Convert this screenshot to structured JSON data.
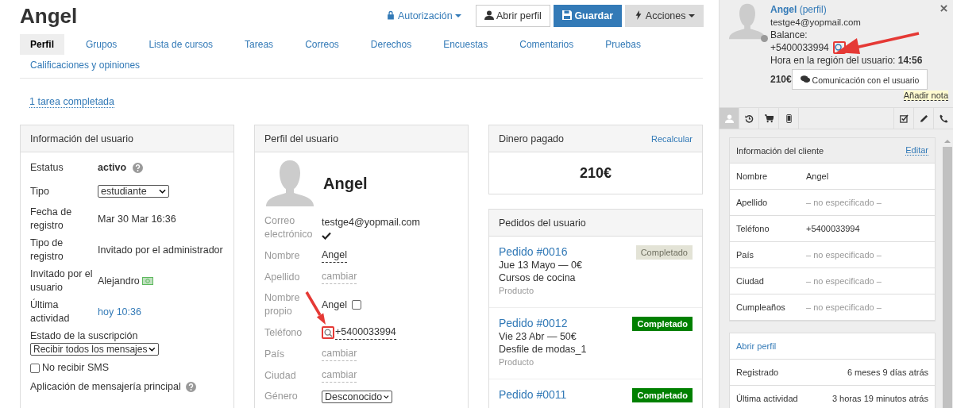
{
  "title": "Angel",
  "toolbar": {
    "authorization": "Autorización",
    "open_profile": "Abrir perfil",
    "save": "Guardar",
    "actions": "Acciones"
  },
  "tabs": [
    {
      "label": "Perfil",
      "selected": true
    },
    {
      "label": "Grupos",
      "selected": false
    },
    {
      "label": "Lista de cursos",
      "selected": false
    },
    {
      "label": "Tareas",
      "selected": false
    },
    {
      "label": "Correos",
      "selected": false
    },
    {
      "label": "Derechos",
      "selected": false
    },
    {
      "label": "Encuestas",
      "selected": false
    },
    {
      "label": "Comentarios",
      "selected": false
    },
    {
      "label": "Pruebas",
      "selected": false
    },
    {
      "label": "Calificaciones y opiniones",
      "selected": false
    }
  ],
  "tasks_link": "1 tarea completada",
  "user_info": {
    "title": "Información del usuario",
    "rows": [
      {
        "kind": "status",
        "label": "Estatus",
        "value": "activo"
      },
      {
        "kind": "select",
        "label": "Tipo",
        "value": "estudiante"
      },
      {
        "kind": "text",
        "label": "Fecha de registro",
        "value": "Mar 30 Mar 16:36"
      },
      {
        "kind": "text",
        "label": "Tipo de registro",
        "value": "Invitado por el administrador"
      },
      {
        "kind": "inviter",
        "label": "Invitado por el usuario",
        "value": "Alejandro"
      },
      {
        "kind": "link",
        "label": "Última actividad",
        "value": "hoy 10:36"
      }
    ],
    "subscription_label": "Estado de la suscripción",
    "subscription_value": "Recibir todos los mensajes",
    "no_sms": {
      "label": "No recibir SMS",
      "checked": false
    },
    "messenger_label": "Aplicación de mensajería principal"
  },
  "profile": {
    "title": "Perfil del usuario",
    "name": "Angel",
    "rows": [
      {
        "kind": "email",
        "label": "Correo electrónico",
        "value": "testge4@yopmail.com",
        "verified": true
      },
      {
        "kind": "editable",
        "label": "Nombre",
        "value": "Angel"
      },
      {
        "kind": "empty",
        "label": "Apellido",
        "value": "cambiar"
      },
      {
        "kind": "own",
        "label": "Nombre propio",
        "value": "Angel",
        "checked": false
      },
      {
        "kind": "phone",
        "label": "Teléfono",
        "value": "+5400033994",
        "highlighted": true
      },
      {
        "kind": "empty",
        "label": "País",
        "value": "cambiar"
      },
      {
        "kind": "empty",
        "label": "Ciudad",
        "value": "cambiar"
      },
      {
        "kind": "select",
        "label": "Género",
        "value": "Desconocido"
      }
    ]
  },
  "money": {
    "title": "Dinero pagado",
    "action": "Recalcular",
    "amount": "210€"
  },
  "orders": {
    "title": "Pedidos del usuario",
    "items": [
      {
        "number": "Pedido #0016",
        "date": "Jue 13 Mayo — 0€",
        "product": "Cursos de cocina",
        "type": "Producto",
        "status": "Completado",
        "faded": true
      },
      {
        "number": "Pedido #0012",
        "date": "Vie 23 Abr — 50€",
        "product": "Desfile de modas_1",
        "type": "Producto",
        "status": "Completado",
        "faded": false
      },
      {
        "number": "Pedido #0011",
        "status": "Completado",
        "faded": false
      }
    ]
  },
  "sidebar": {
    "name": "Angel",
    "profile_link": "(perfil)",
    "email": "testge4@yopmail.com",
    "balance_label": "Balance:",
    "phone": "+5400033994",
    "phone_highlighted": true,
    "time": "Hora en la región del usuario: **14:56**",
    "balance": "210€",
    "contact_button": "Comunicación con el usuario",
    "add_note": "Añadir nota",
    "tabs": [
      {
        "kind": "user",
        "selected": true
      },
      {
        "kind": "history",
        "selected": false
      },
      {
        "kind": "cart",
        "selected": false
      },
      {
        "kind": "mobile",
        "selected": false
      },
      {
        "kind": "task",
        "selected": false
      },
      {
        "kind": "edit",
        "selected": false
      },
      {
        "kind": "phone",
        "selected": false
      }
    ],
    "client": {
      "title": "Información del cliente",
      "edit": "Editar",
      "rows": [
        {
          "label": "Nombre",
          "value": "Angel",
          "specified": true
        },
        {
          "label": "Apellido",
          "value": "– no especificado –",
          "specified": false
        },
        {
          "label": "Teléfono",
          "value": "+5400033994",
          "specified": true
        },
        {
          "label": "País",
          "value": "– no especificado –",
          "specified": false
        },
        {
          "label": "Ciudad",
          "value": "– no especificado –",
          "specified": false
        },
        {
          "label": "Cumpleaños",
          "value": "– no especificado –",
          "specified": false
        }
      ]
    },
    "summary": {
      "link": "Abrir perfil",
      "rows": [
        {
          "label": "Registrado",
          "value": "6 meses 9 días atrás"
        },
        {
          "label": "Última actividad",
          "value": "3 horas 19 minutos atrás"
        }
      ]
    }
  }
}
